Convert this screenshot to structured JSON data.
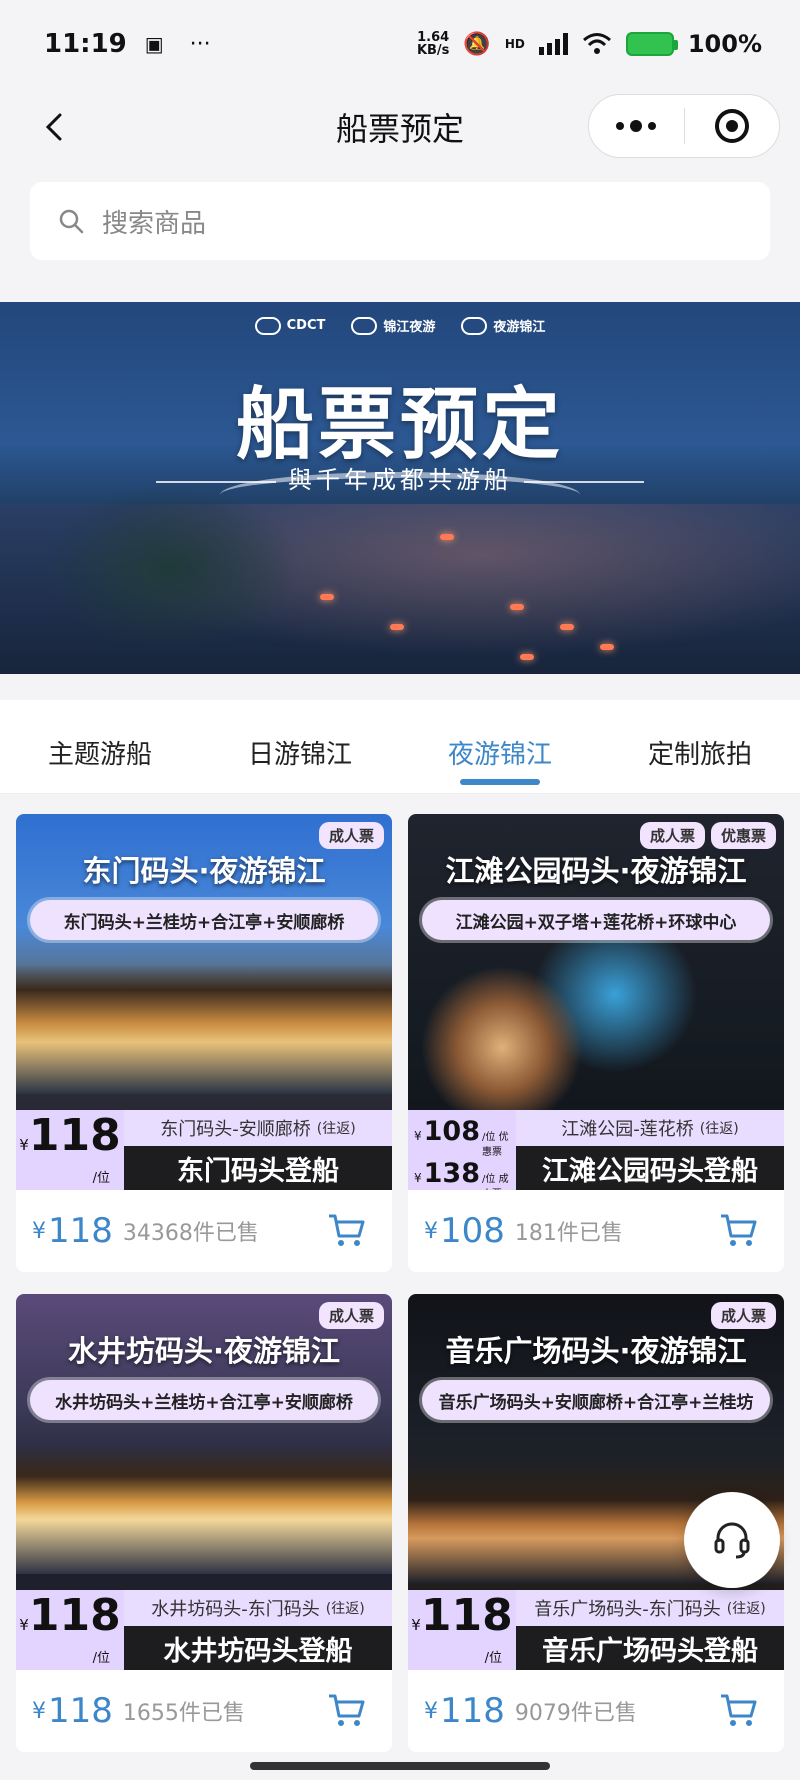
{
  "status": {
    "time": "11:19",
    "dots": "···",
    "net_speed": "1.64",
    "net_unit": "KB/s",
    "hd": "HD",
    "battery": "100%"
  },
  "nav": {
    "title": "船票预定"
  },
  "search": {
    "placeholder": "搜索商品"
  },
  "banner": {
    "logos": [
      "CDCT",
      "锦江夜游",
      "夜游锦江"
    ],
    "title": "船票预定",
    "subtitle": "與千年成都共游船"
  },
  "tabs": [
    {
      "label": "主题游船"
    },
    {
      "label": "日游锦江"
    },
    {
      "label": "夜游锦江",
      "active": true
    },
    {
      "label": "定制旅拍"
    }
  ],
  "colors": {
    "accent": "#3d87c9",
    "tag_bg": "#e3d4ff"
  },
  "products": [
    {
      "tags": [
        "成人票"
      ],
      "title": "东门码头·夜游锦江",
      "route": "东门码头+兰桂坊+合江亭+安顺廊桥",
      "price_big": "118",
      "price_unit": "/位",
      "segment": "东门码头-安顺廊桥",
      "segment_note": "(往返)",
      "boarding": "东门码头登船",
      "currency": "¥",
      "price": "118",
      "sold": "34368件已售"
    },
    {
      "tags": [
        "成人票",
        "优惠票"
      ],
      "title": "江滩公园码头·夜游锦江",
      "route": "江滩公园+双子塔+莲花桥+环球中心",
      "price_discount": "108",
      "price_discount_label": "/位 优惠票",
      "price_adult": "138",
      "price_adult_label": "/位 成人票",
      "segment": "江滩公园-莲花桥",
      "segment_note": "(往返)",
      "boarding": "江滩公园码头登船",
      "currency": "¥",
      "price": "108",
      "sold": "181件已售"
    },
    {
      "tags": [
        "成人票"
      ],
      "title": "水井坊码头·夜游锦江",
      "route": "水井坊码头+兰桂坊+合江亭+安顺廊桥",
      "price_big": "118",
      "price_unit": "/位",
      "segment": "水井坊码头-东门码头",
      "segment_note": "(往返)",
      "boarding": "水井坊码头登船",
      "currency": "¥",
      "price": "118",
      "sold": "1655件已售"
    },
    {
      "tags": [
        "成人票"
      ],
      "title": "音乐广场码头·夜游锦江",
      "route": "音乐广场码头+安顺廊桥+合江亭+兰桂坊",
      "price_big": "118",
      "price_unit": "/位",
      "segment": "音乐广场码头-东门码头",
      "segment_note": "(往返)",
      "boarding": "音乐广场码头登船",
      "currency": "¥",
      "price": "118",
      "sold": "9079件已售"
    }
  ]
}
